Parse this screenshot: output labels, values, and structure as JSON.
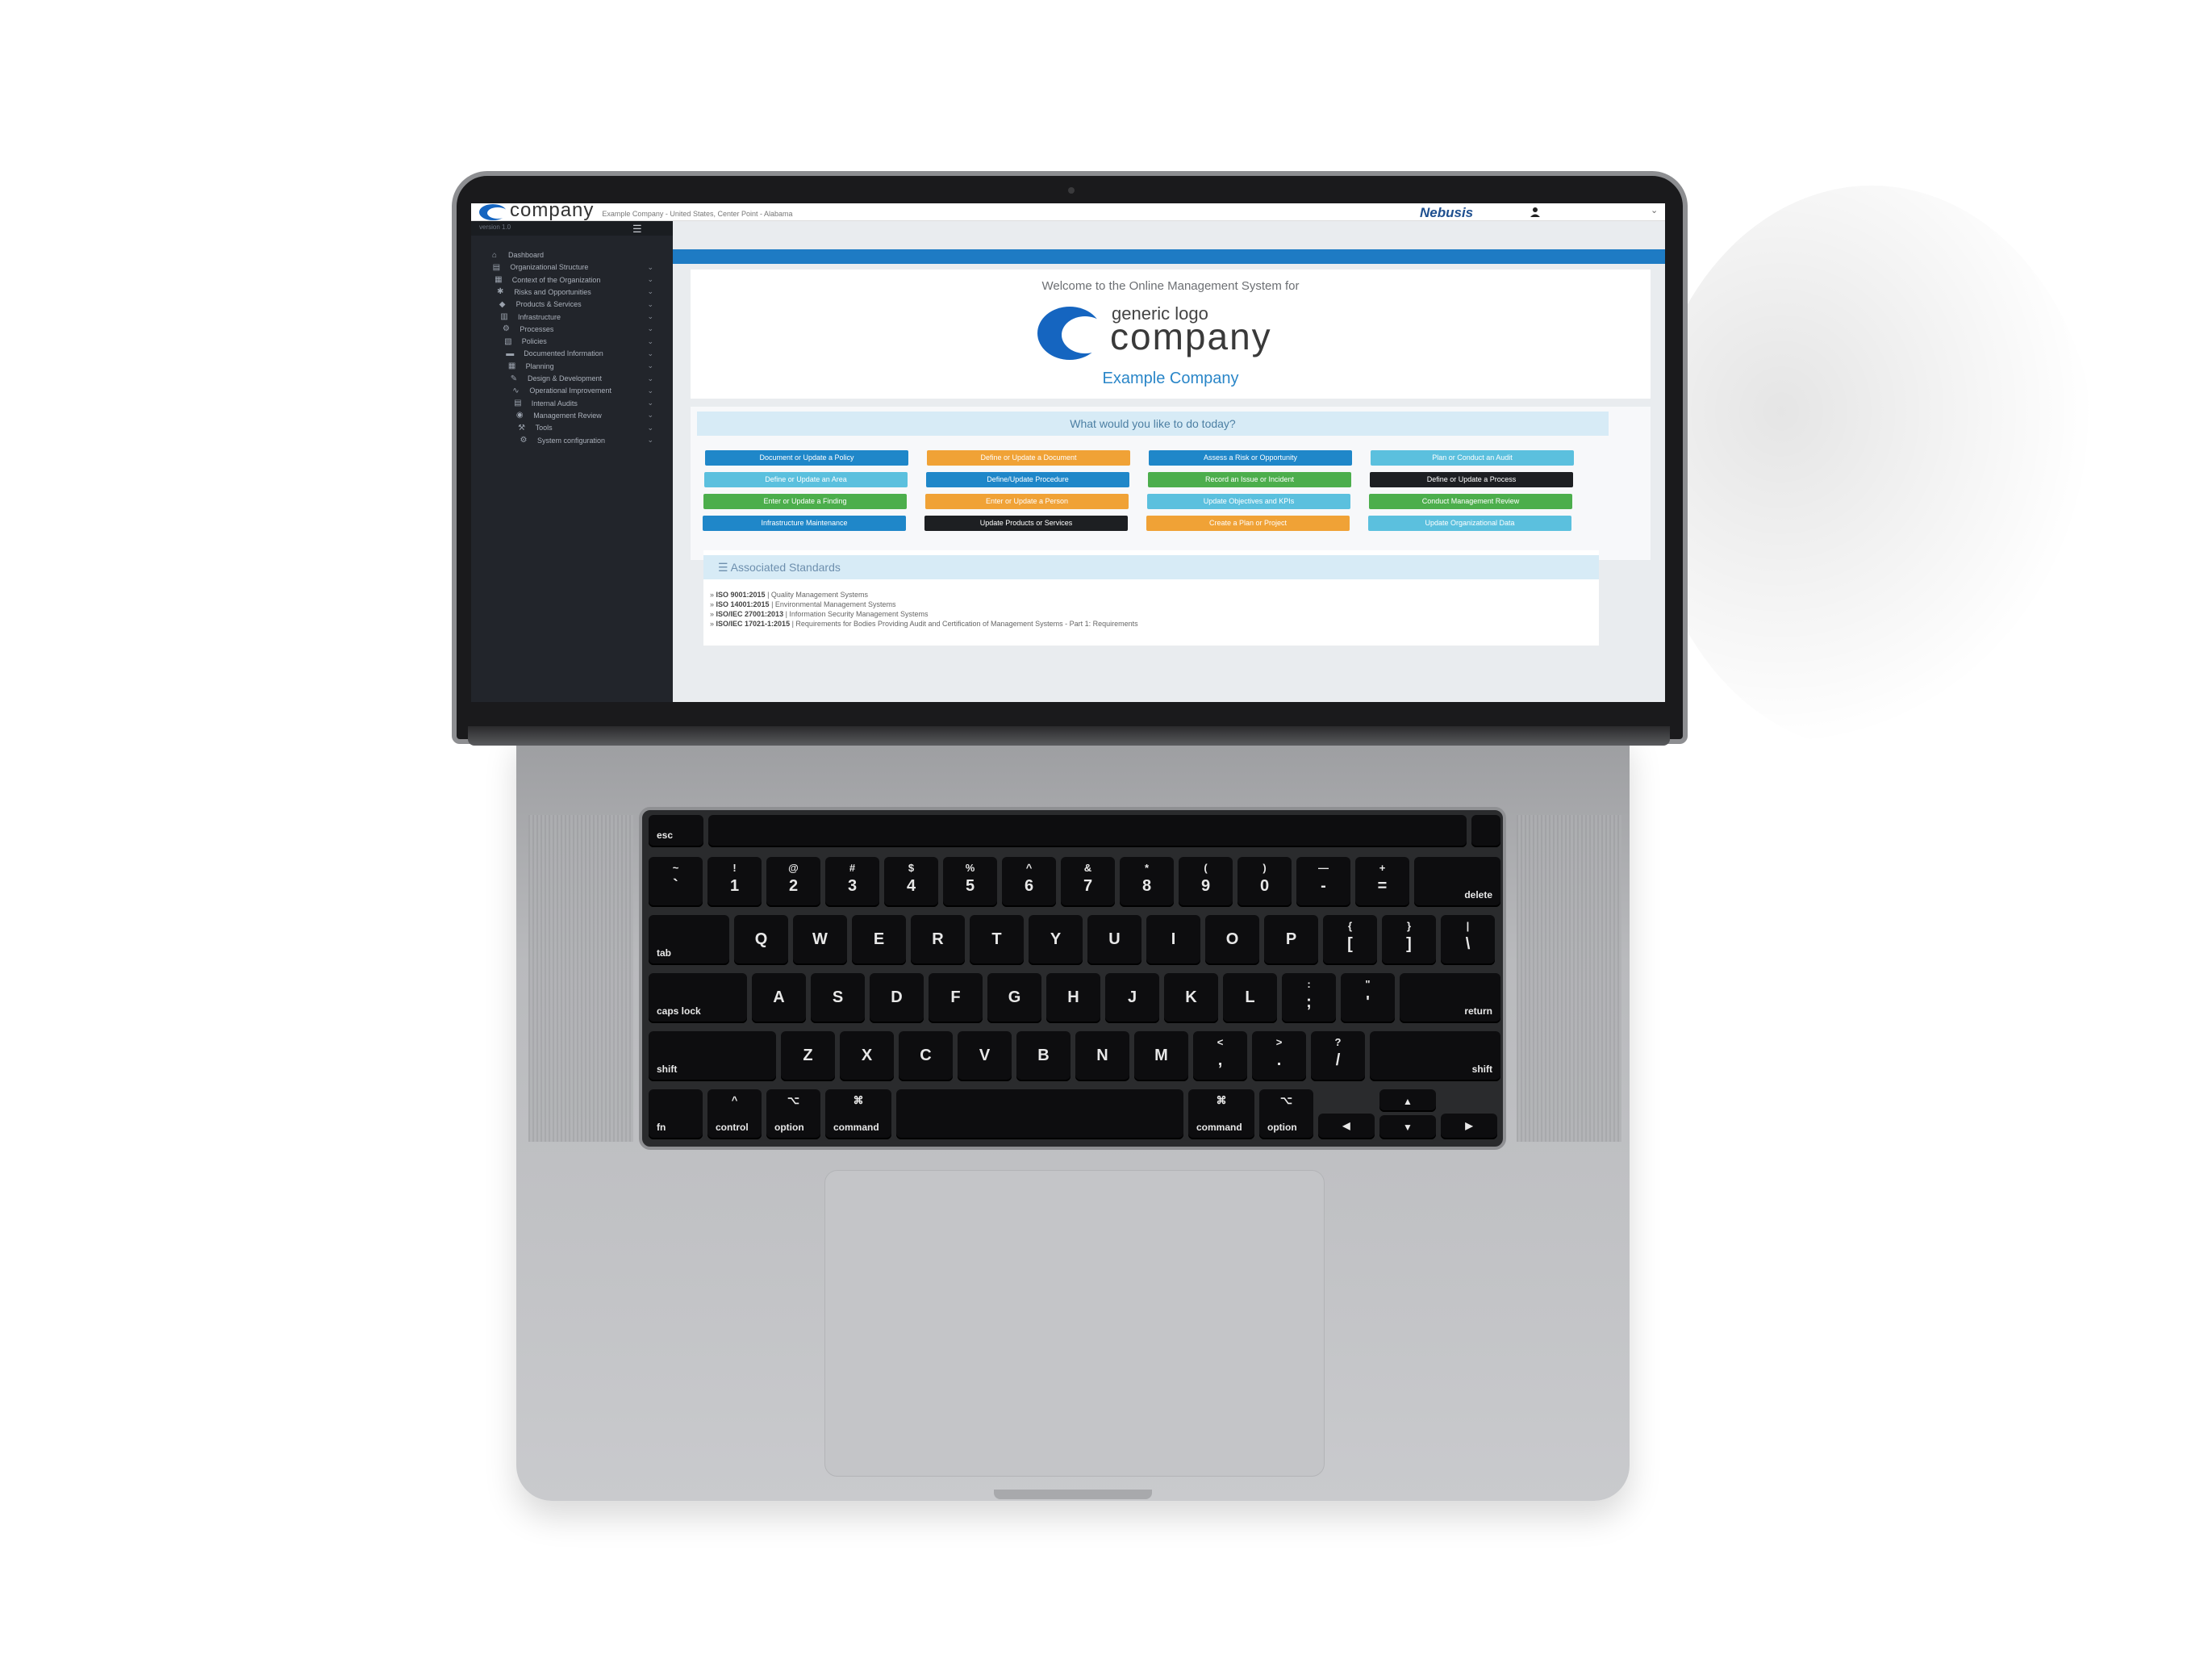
{
  "topbar": {
    "brand": "company",
    "location": "Example Company - United States, Center Point - Alabama",
    "vendor": "Nebusis"
  },
  "sidebar": {
    "version": "version 1.0",
    "items": [
      {
        "label": "Dashboard",
        "icon": "home-icon"
      },
      {
        "label": "Organizational Structure",
        "icon": "sitemap-icon"
      },
      {
        "label": "Context of the Organization",
        "icon": "building-icon"
      },
      {
        "label": "Risks and Opportunities",
        "icon": "bug-icon"
      },
      {
        "label": "Products & Services",
        "icon": "cubes-icon"
      },
      {
        "label": "Infrastructure",
        "icon": "server-icon"
      },
      {
        "label": "Processes",
        "icon": "gears-icon"
      },
      {
        "label": "Policies",
        "icon": "documents-icon"
      },
      {
        "label": "Documented Information",
        "icon": "folder-icon"
      },
      {
        "label": "Planning",
        "icon": "calendar-icon"
      },
      {
        "label": "Design & Development",
        "icon": "pencil-icon"
      },
      {
        "label": "Operational Improvement",
        "icon": "line-chart-icon"
      },
      {
        "label": "Internal Audits",
        "icon": "clipboard-icon"
      },
      {
        "label": "Management Review",
        "icon": "eye-icon"
      },
      {
        "label": "Tools",
        "icon": "wrench-icon"
      },
      {
        "label": "System configuration",
        "icon": "cog-icon"
      }
    ]
  },
  "welcome": {
    "intro": "Welcome to the Online Management System for",
    "logo_top": "generic logo",
    "logo_word": "company",
    "company": "Example Company"
  },
  "actions": {
    "heading": "What would you like to do today?",
    "buttons": [
      {
        "label": "Document or Update a Policy",
        "color": "#1f87c9"
      },
      {
        "label": "Define or Update a Document",
        "color": "#f0a236"
      },
      {
        "label": "Assess a Risk or Opportunity",
        "color": "#1f87c9"
      },
      {
        "label": "Plan or Conduct an Audit",
        "color": "#5bc0de"
      },
      {
        "label": "Define or Update an Area",
        "color": "#5bc0de"
      },
      {
        "label": "Define/Update Procedure",
        "color": "#1f87c9"
      },
      {
        "label": "Record an Issue or Incident",
        "color": "#4cae4c"
      },
      {
        "label": "Define or Update a Process",
        "color": "#1d1f22"
      },
      {
        "label": "Enter or Update a Finding",
        "color": "#4cae4c"
      },
      {
        "label": "Enter or Update a Person",
        "color": "#f0a236"
      },
      {
        "label": "Update Objectives and KPIs",
        "color": "#5bc0de"
      },
      {
        "label": "Conduct Management Review",
        "color": "#4cae4c"
      },
      {
        "label": "Infrastructure Maintenance",
        "color": "#1f87c9"
      },
      {
        "label": "Update Products or Services",
        "color": "#1d1f22"
      },
      {
        "label": "Create a Plan or Project",
        "color": "#f0a236"
      },
      {
        "label": "Update Organizational Data",
        "color": "#5bc0de"
      }
    ]
  },
  "standards": {
    "heading": "Associated Standards",
    "items": [
      {
        "code": "ISO 9001:2015",
        "desc": "Quality Management Systems"
      },
      {
        "code": "ISO 14001:2015",
        "desc": "Environmental Management Systems"
      },
      {
        "code": "ISO/IEC 27001:2013",
        "desc": "Information Security Management Systems"
      },
      {
        "code": "ISO/IEC 17021-1:2015",
        "desc": "Requirements for Bodies Providing Audit and Certification of Management Systems - Part 1: Requirements"
      }
    ]
  },
  "keyboard": {
    "esc": "esc",
    "row1": [
      {
        "top": "~",
        "main": "`"
      },
      {
        "top": "!",
        "main": "1"
      },
      {
        "top": "@",
        "main": "2"
      },
      {
        "top": "#",
        "main": "3"
      },
      {
        "top": "$",
        "main": "4"
      },
      {
        "top": "%",
        "main": "5"
      },
      {
        "top": "^",
        "main": "6"
      },
      {
        "top": "&",
        "main": "7"
      },
      {
        "top": "*",
        "main": "8"
      },
      {
        "top": "(",
        "main": "9"
      },
      {
        "top": ")",
        "main": "0"
      },
      {
        "top": "—",
        "main": "-"
      },
      {
        "top": "+",
        "main": "="
      }
    ],
    "delete": "delete",
    "tab": "tab",
    "row2": [
      "Q",
      "W",
      "E",
      "R",
      "T",
      "Y",
      "U",
      "I",
      "O",
      "P"
    ],
    "row2_sym": [
      {
        "top": "{",
        "main": "["
      },
      {
        "top": "}",
        "main": "]"
      },
      {
        "top": "|",
        "main": "\\"
      }
    ],
    "caps": "caps lock",
    "row3": [
      "A",
      "S",
      "D",
      "F",
      "G",
      "H",
      "J",
      "K",
      "L"
    ],
    "row3_sym": [
      {
        "top": ":",
        "main": ";"
      },
      {
        "top": "\"",
        "main": "'"
      }
    ],
    "return": "return",
    "shift": "shift",
    "row4": [
      "Z",
      "X",
      "C",
      "V",
      "B",
      "N",
      "M"
    ],
    "row4_sym": [
      {
        "top": "<",
        "main": ","
      },
      {
        "top": ">",
        "main": "."
      },
      {
        "top": "?",
        "main": "/"
      }
    ],
    "fn": "fn",
    "control": "control",
    "option": "option",
    "command": "command",
    "ctrl_sym": "^",
    "opt_sym": "⌥",
    "cmd_sym": "⌘",
    "arrows": {
      "left": "◀",
      "right": "▶",
      "up": "▲",
      "down": "▼"
    }
  }
}
